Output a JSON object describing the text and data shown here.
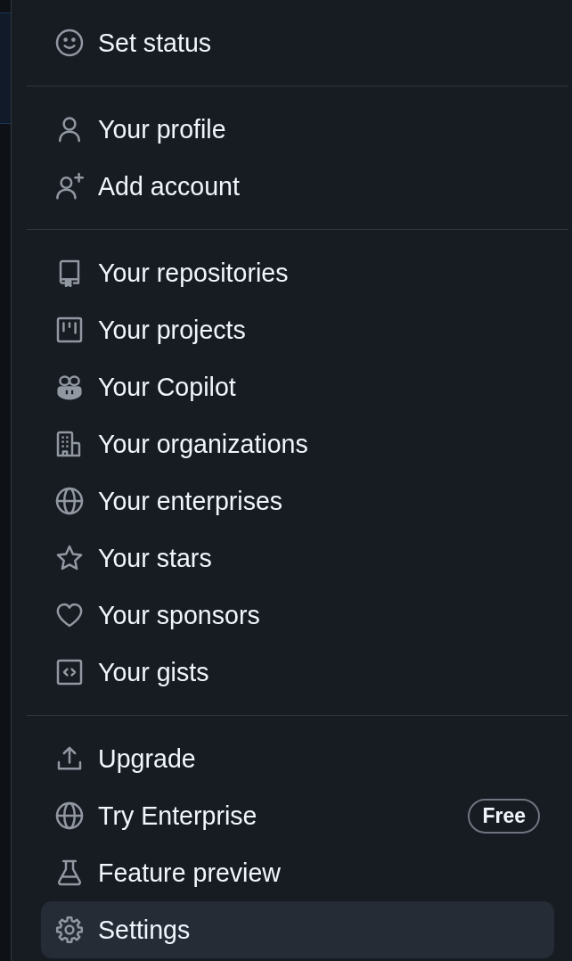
{
  "menu": {
    "sections": [
      {
        "items": [
          {
            "label": "Set status",
            "selected": false
          }
        ]
      },
      {
        "items": [
          {
            "label": "Your profile",
            "selected": false
          },
          {
            "label": "Add account",
            "selected": false
          }
        ]
      },
      {
        "items": [
          {
            "label": "Your repositories",
            "selected": false
          },
          {
            "label": "Your projects",
            "selected": false
          },
          {
            "label": "Your Copilot",
            "selected": false
          },
          {
            "label": "Your organizations",
            "selected": false
          },
          {
            "label": "Your enterprises",
            "selected": false
          },
          {
            "label": "Your stars",
            "selected": false
          },
          {
            "label": "Your sponsors",
            "selected": false
          },
          {
            "label": "Your gists",
            "selected": false
          }
        ]
      },
      {
        "items": [
          {
            "label": "Upgrade",
            "selected": false
          },
          {
            "label": "Try Enterprise",
            "badge": "Free",
            "selected": false
          },
          {
            "label": "Feature preview",
            "selected": false
          },
          {
            "label": "Settings",
            "selected": true
          }
        ]
      }
    ]
  }
}
